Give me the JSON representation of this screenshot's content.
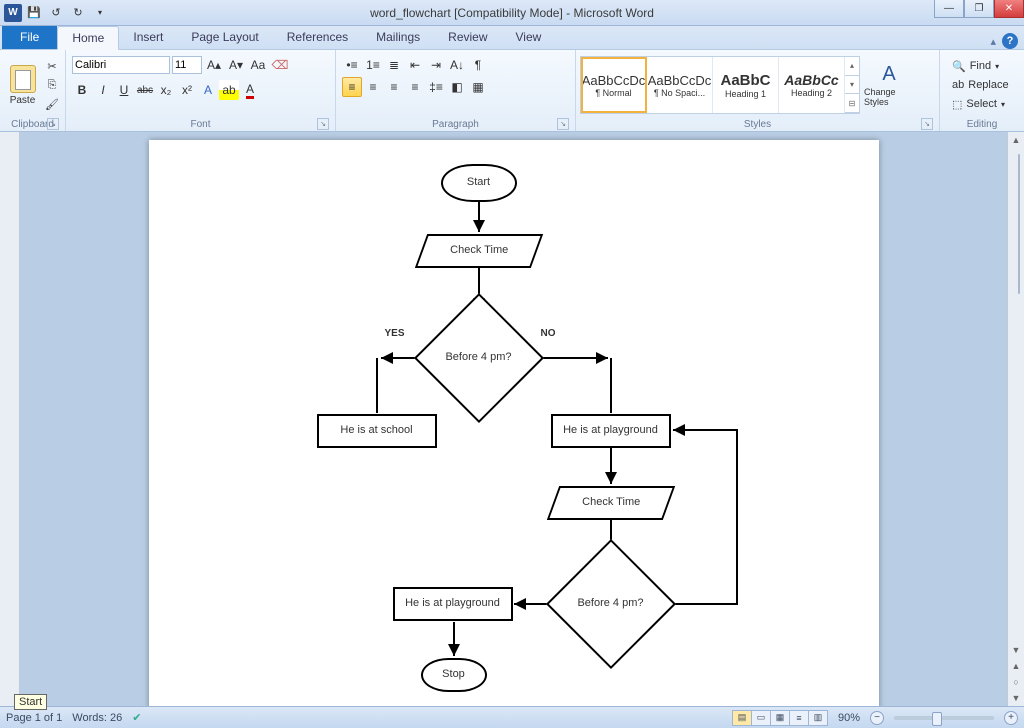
{
  "window": {
    "title": "word_flowchart [Compatibility Mode] - Microsoft Word"
  },
  "tabs": {
    "file": "File",
    "home": "Home",
    "insert": "Insert",
    "pageLayout": "Page Layout",
    "references": "References",
    "mailings": "Mailings",
    "review": "Review",
    "view": "View"
  },
  "clipboard": {
    "paste": "Paste",
    "label": "Clipboard"
  },
  "font": {
    "name": "Calibri",
    "size": "11",
    "label": "Font",
    "bold": "B",
    "italic": "I",
    "underline": "U",
    "strike": "abc",
    "sub": "x₂",
    "sup": "x²"
  },
  "paragraph": {
    "label": "Paragraph"
  },
  "styles": {
    "label": "Styles",
    "items": [
      {
        "preview": "AaBbCcDc",
        "name": "¶ Normal"
      },
      {
        "preview": "AaBbCcDc",
        "name": "¶ No Spaci..."
      },
      {
        "preview": "AaBbC",
        "name": "Heading 1"
      },
      {
        "preview": "AaBbCc",
        "name": "Heading 2"
      }
    ],
    "change": "Change Styles"
  },
  "editing": {
    "find": "Find",
    "replace": "Replace",
    "select": "Select",
    "label": "Editing"
  },
  "flowchart": {
    "start": "Start",
    "check1": "Check Time",
    "dec1": "Before 4 pm?",
    "yes": "YES",
    "no": "NO",
    "school": "He is at school",
    "play1": "He is at playground",
    "check2": "Check Time",
    "dec2": "Before 4 pm?",
    "play2": "He is at playground",
    "stop": "Stop"
  },
  "status": {
    "page": "Page 1 of 1",
    "words": "Words: 26",
    "zoom": "90%"
  },
  "tooltip": {
    "start": "Start"
  }
}
